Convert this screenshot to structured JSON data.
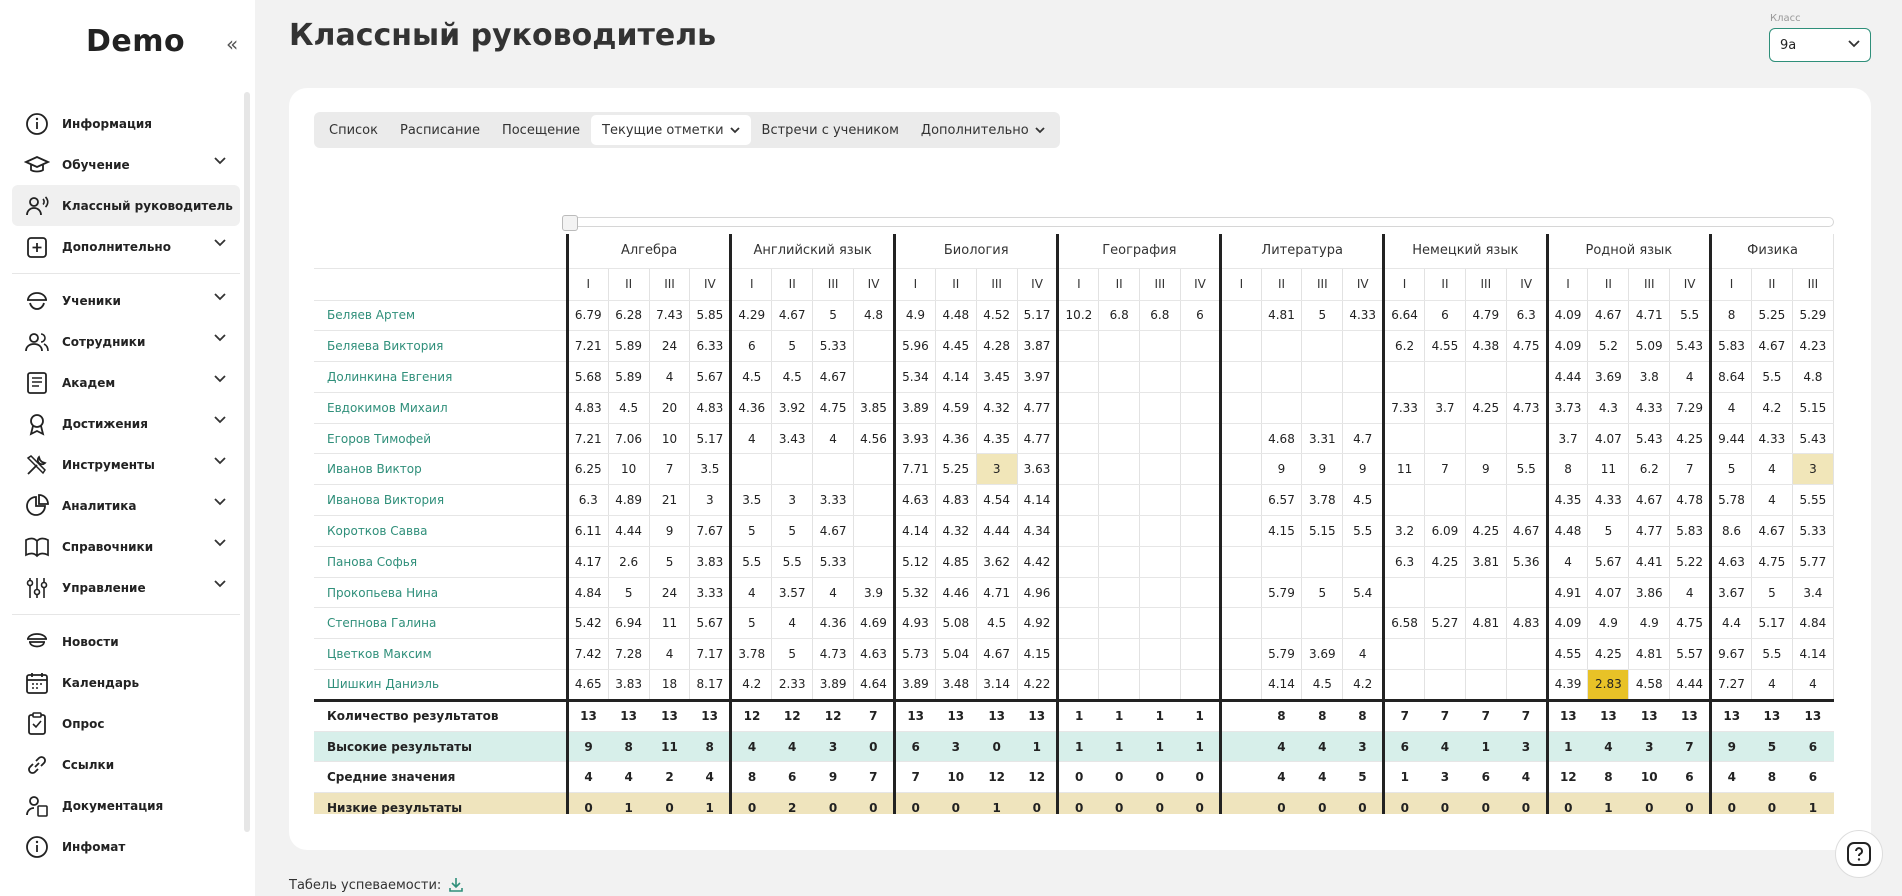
{
  "app": {
    "logo": "Demo"
  },
  "sidebar": {
    "items": [
      {
        "label": "Информация",
        "icon": "info-icon",
        "chevron": false
      },
      {
        "label": "Обучение",
        "icon": "graduation-cap-icon",
        "chevron": true
      },
      {
        "label": "Классный руководитель",
        "icon": "user-voice-icon",
        "chevron": false,
        "active": true
      },
      {
        "label": "Дополнительно",
        "icon": "plus-folder-icon",
        "chevron": true
      },
      {
        "label": "Ученики",
        "icon": "student-cap-icon",
        "chevron": true
      },
      {
        "label": "Сотрудники",
        "icon": "people-icon",
        "chevron": true
      },
      {
        "label": "Академ",
        "icon": "book-icon",
        "chevron": true
      },
      {
        "label": "Достижения",
        "icon": "award-icon",
        "chevron": true
      },
      {
        "label": "Инструменты",
        "icon": "tools-icon",
        "chevron": true
      },
      {
        "label": "Аналитика",
        "icon": "pie-chart-icon",
        "chevron": true
      },
      {
        "label": "Справочники",
        "icon": "open-book-icon",
        "chevron": true
      },
      {
        "label": "Управление",
        "icon": "settings-sliders-icon",
        "chevron": true
      },
      {
        "label": "Новости",
        "icon": "news-icon",
        "chevron": false
      },
      {
        "label": "Календарь",
        "icon": "calendar-icon",
        "chevron": false
      },
      {
        "label": "Опрос",
        "icon": "clipboard-icon",
        "chevron": false
      },
      {
        "label": "Ссылки",
        "icon": "link-icon",
        "chevron": false
      },
      {
        "label": "Документация",
        "icon": "person-doc-icon",
        "chevron": false
      },
      {
        "label": "Инфомат",
        "icon": "info-icon",
        "chevron": false
      }
    ]
  },
  "header": {
    "title": "Классный руководитель",
    "class_label": "Класс",
    "class_value": "9а"
  },
  "tabs": [
    "Список",
    "Расписание",
    "Посещение",
    "Текущие отметки",
    "Встречи с учеником",
    "Дополнительно"
  ],
  "tabel_label": "Табель успеваемости:",
  "grid": {
    "subjects": [
      "Алгебра",
      "Английский язык",
      "Биология",
      "География",
      "Литература",
      "Немецкий язык",
      "Родной язык",
      "Физика"
    ],
    "quarters": [
      "I",
      "II",
      "III",
      "IV"
    ],
    "students": [
      {
        "name": "Беляев Артем",
        "v": [
          "6.79",
          "6.28",
          "7.43",
          "5.85",
          "4.29",
          "4.67",
          "5",
          "4.8",
          "4.9",
          "4.48",
          "4.52",
          "5.17",
          "10.2",
          "6.8",
          "6.8",
          "6",
          "",
          "4.81",
          "5",
          "4.33",
          "6.64",
          "6",
          "4.79",
          "6.3",
          "4.09",
          "4.67",
          "4.71",
          "5.5",
          "8",
          "5.25",
          "5.29"
        ]
      },
      {
        "name": "Беляева Виктория",
        "v": [
          "7.21",
          "5.89",
          "24",
          "6.33",
          "6",
          "5",
          "5.33",
          "",
          "5.96",
          "4.45",
          "4.28",
          "3.87",
          "",
          "",
          "",
          "",
          "",
          "",
          "",
          "",
          "6.2",
          "4.55",
          "4.38",
          "4.75",
          "4.09",
          "5.2",
          "5.09",
          "5.43",
          "5.83",
          "4.67",
          "4.23"
        ]
      },
      {
        "name": "Долинкина Евгения",
        "v": [
          "5.68",
          "5.89",
          "4",
          "5.67",
          "4.5",
          "4.5",
          "4.67",
          "",
          "5.34",
          "4.14",
          "3.45",
          "3.97",
          "",
          "",
          "",
          "",
          "",
          "",
          "",
          "",
          "",
          "",
          "",
          "",
          "4.44",
          "3.69",
          "3.8",
          "4",
          "8.64",
          "5.5",
          "4.8"
        ]
      },
      {
        "name": "Евдокимов Михаил",
        "v": [
          "4.83",
          "4.5",
          "20",
          "4.83",
          "4.36",
          "3.92",
          "4.75",
          "3.85",
          "3.89",
          "4.59",
          "4.32",
          "4.77",
          "",
          "",
          "",
          "",
          "",
          "",
          "",
          "",
          "7.33",
          "3.7",
          "4.25",
          "4.73",
          "3.73",
          "4.3",
          "4.33",
          "7.29",
          "4",
          "4.2",
          "5.15"
        ]
      },
      {
        "name": "Егоров Тимофей",
        "v": [
          "7.21",
          "7.06",
          "10",
          "5.17",
          "4",
          "3.43",
          "4",
          "4.56",
          "3.93",
          "4.36",
          "4.35",
          "4.77",
          "",
          "",
          "",
          "",
          "",
          "4.68",
          "3.31",
          "4.7",
          "",
          "",
          "",
          "",
          "3.7",
          "4.07",
          "5.43",
          "4.25",
          "9.44",
          "4.33",
          "5.43"
        ]
      },
      {
        "name": "Иванов Виктор",
        "v": [
          "6.25",
          "10",
          "7",
          "3.5",
          "",
          "",
          "",
          "",
          "7.71",
          "5.25",
          "3",
          "3.63",
          "",
          "",
          "",
          "",
          "",
          "9",
          "9",
          "9",
          "11",
          "7",
          "9",
          "5.5",
          "8",
          "11",
          "6.2",
          "7",
          "5",
          "4",
          "3"
        ]
      },
      {
        "name": "Иванова Виктория",
        "v": [
          "6.3",
          "4.89",
          "21",
          "3",
          "3.5",
          "3",
          "3.33",
          "",
          "4.63",
          "4.83",
          "4.54",
          "4.14",
          "",
          "",
          "",
          "",
          "",
          "6.57",
          "3.78",
          "4.5",
          "",
          "",
          "",
          "",
          "4.35",
          "4.33",
          "4.67",
          "4.78",
          "5.78",
          "4",
          "5.55"
        ]
      },
      {
        "name": "Коротков Савва",
        "v": [
          "6.11",
          "4.44",
          "9",
          "7.67",
          "5",
          "5",
          "4.67",
          "",
          "4.14",
          "4.32",
          "4.44",
          "4.34",
          "",
          "",
          "",
          "",
          "",
          "4.15",
          "5.15",
          "5.5",
          "3.2",
          "6.09",
          "4.25",
          "4.67",
          "4.48",
          "5",
          "4.77",
          "5.83",
          "8.6",
          "4.67",
          "5.33"
        ]
      },
      {
        "name": "Панова Софья",
        "v": [
          "4.17",
          "2.6",
          "5",
          "3.83",
          "5.5",
          "5.5",
          "5.33",
          "",
          "5.12",
          "4.85",
          "3.62",
          "4.42",
          "",
          "",
          "",
          "",
          "",
          "",
          "",
          "",
          "6.3",
          "4.25",
          "3.81",
          "5.36",
          "4",
          "5.67",
          "4.41",
          "5.22",
          "4.63",
          "4.75",
          "5.77"
        ]
      },
      {
        "name": "Прокопьева Нина",
        "v": [
          "4.84",
          "5",
          "24",
          "3.33",
          "4",
          "3.57",
          "4",
          "3.9",
          "5.32",
          "4.46",
          "4.71",
          "4.96",
          "",
          "",
          "",
          "",
          "",
          "5.79",
          "5",
          "5.4",
          "",
          "",
          "",
          "",
          "4.91",
          "4.07",
          "3.86",
          "4",
          "3.67",
          "5",
          "3.4"
        ]
      },
      {
        "name": "Степнова Галина",
        "v": [
          "5.42",
          "6.94",
          "11",
          "5.67",
          "5",
          "4",
          "4.36",
          "4.69",
          "4.93",
          "5.08",
          "4.5",
          "4.92",
          "",
          "",
          "",
          "",
          "",
          "",
          "",
          "",
          "6.58",
          "5.27",
          "4.81",
          "4.83",
          "4.09",
          "4.9",
          "4.9",
          "4.75",
          "4.4",
          "5.17",
          "4.84"
        ]
      },
      {
        "name": "Цветков Максим",
        "v": [
          "7.42",
          "7.28",
          "4",
          "7.17",
          "3.78",
          "5",
          "4.73",
          "4.63",
          "5.73",
          "5.04",
          "4.67",
          "4.15",
          "",
          "",
          "",
          "",
          "",
          "5.79",
          "3.69",
          "4",
          "",
          "",
          "",
          "",
          "4.55",
          "4.25",
          "4.81",
          "5.57",
          "9.67",
          "5.5",
          "4.14"
        ]
      },
      {
        "name": "Шишкин Даниэль",
        "v": [
          "4.65",
          "3.83",
          "18",
          "8.17",
          "4.2",
          "2.33",
          "3.89",
          "4.64",
          "3.89",
          "3.48",
          "3.14",
          "4.22",
          "",
          "",
          "",
          "",
          "",
          "4.14",
          "4.5",
          "4.2",
          "",
          "",
          "",
          "",
          "4.39",
          "2.83",
          "4.58",
          "4.44",
          "7.27",
          "4",
          "4"
        ]
      }
    ],
    "summary": [
      {
        "label": "Количество результатов",
        "v": [
          "13",
          "13",
          "13",
          "13",
          "12",
          "12",
          "12",
          "7",
          "13",
          "13",
          "13",
          "13",
          "1",
          "1",
          "1",
          "1",
          "",
          "8",
          "8",
          "8",
          "7",
          "7",
          "7",
          "7",
          "13",
          "13",
          "13",
          "13",
          "13",
          "13",
          "13"
        ]
      },
      {
        "label": "Высокие результаты",
        "v": [
          "9",
          "8",
          "11",
          "8",
          "4",
          "4",
          "3",
          "0",
          "6",
          "3",
          "0",
          "1",
          "1",
          "1",
          "1",
          "1",
          "",
          "4",
          "4",
          "3",
          "6",
          "4",
          "1",
          "3",
          "1",
          "4",
          "3",
          "7",
          "9",
          "5",
          "6"
        ]
      },
      {
        "label": "Средние значения",
        "v": [
          "4",
          "4",
          "2",
          "4",
          "8",
          "6",
          "9",
          "7",
          "7",
          "10",
          "12",
          "12",
          "0",
          "0",
          "0",
          "0",
          "",
          "4",
          "4",
          "5",
          "1",
          "3",
          "6",
          "4",
          "12",
          "8",
          "10",
          "6",
          "4",
          "8",
          "6"
        ]
      },
      {
        "label": "Низкие результаты",
        "v": [
          "0",
          "1",
          "0",
          "1",
          "0",
          "2",
          "0",
          "0",
          "0",
          "0",
          "1",
          "0",
          "0",
          "0",
          "0",
          "0",
          "",
          "0",
          "0",
          "0",
          "0",
          "0",
          "0",
          "0",
          "0",
          "1",
          "0",
          "0",
          "0",
          "0",
          "1"
        ]
      }
    ]
  },
  "colors": {
    "accent": "#2f8f7a",
    "high_bg": "#d7efea",
    "low_bg": "#efe4bd",
    "highlight": "#f1e6b9",
    "highlight_strong": "#e8c227"
  }
}
